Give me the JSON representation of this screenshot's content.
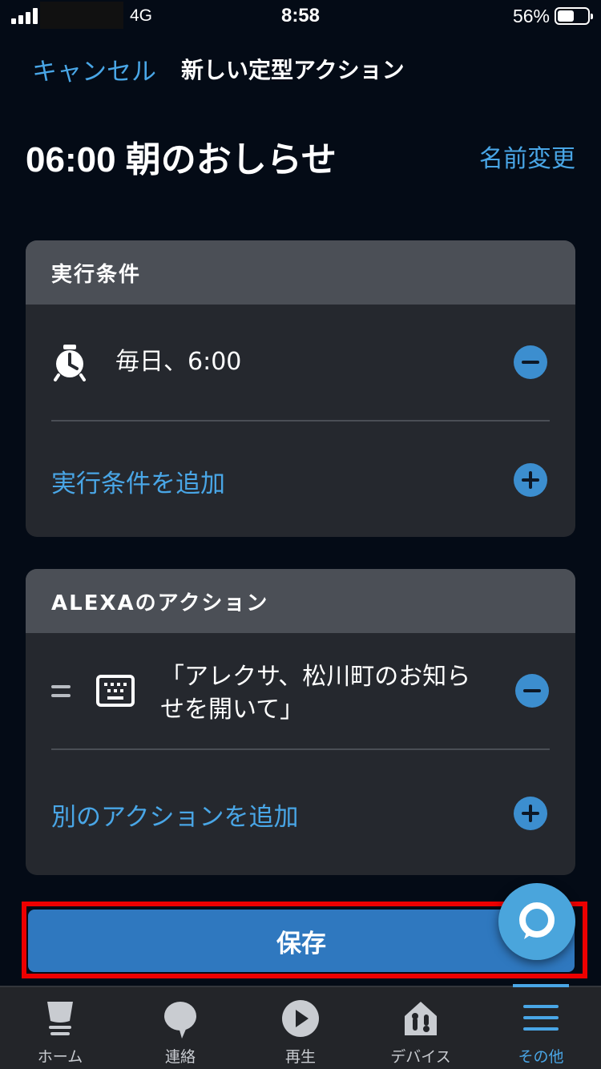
{
  "status_bar": {
    "network": "4G",
    "time": "8:58",
    "battery_percent": "56%",
    "battery_level": 0.56
  },
  "nav": {
    "cancel_label": "キャンセル",
    "title": "新しい定型アクション"
  },
  "routine": {
    "name": "06:00 朝のおしらせ",
    "rename_label": "名前変更"
  },
  "trigger_card": {
    "header": "実行条件",
    "trigger_text": "毎日、6:00",
    "trigger_icon": "alarm-clock-icon",
    "add_label": "実行条件を追加"
  },
  "action_card": {
    "header": "ALEXAのアクション",
    "action_line1": "「アレクサ、松川町のお知ら",
    "action_line2": "せを開いて」",
    "action_icon": "keyboard-icon",
    "add_label": "別のアクションを追加"
  },
  "save_label": "保存",
  "tabs": [
    {
      "label": "ホーム",
      "icon": "home-icon"
    },
    {
      "label": "連絡",
      "icon": "chat-bubble-icon"
    },
    {
      "label": "再生",
      "icon": "play-icon"
    },
    {
      "label": "デバイス",
      "icon": "devices-house-icon"
    },
    {
      "label": "その他",
      "icon": "menu-lines-icon",
      "active": true
    }
  ],
  "colors": {
    "accent": "#49a6e6",
    "save_button": "#2f78bf",
    "highlight_border": "#ee0000",
    "background": "#040b16"
  }
}
